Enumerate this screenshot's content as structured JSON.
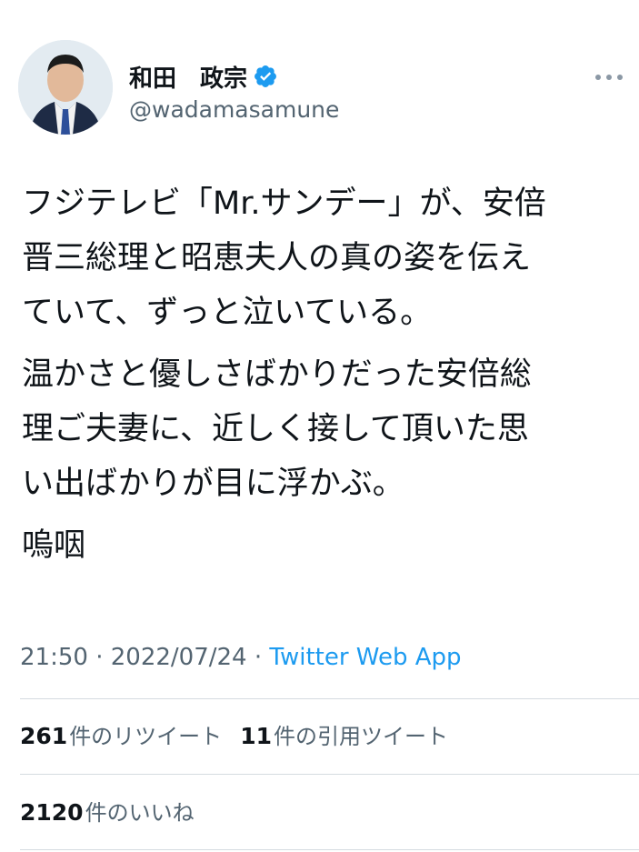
{
  "author": {
    "display_name": "和田　政宗",
    "handle": "@wadamasamune",
    "verified_icon": "verified-badge-icon",
    "avatar_icon": "profile-photo"
  },
  "tweet": {
    "paragraphs": [
      "フジテレビ「Mr.サンデー」が、安倍\n晋三総理と昭恵夫人の真の姿を伝え\nていて、ずっと泣いている。",
      "温かさと優しさばかりだった安倍総\n理ご夫妻に、近しく接して頂いた思\nい出ばかりが目に浮かぶ。",
      "嗚咽"
    ]
  },
  "meta": {
    "time": "21:50",
    "separator": " · ",
    "date": "2022/07/24",
    "source": "Twitter Web App"
  },
  "stats": {
    "retweets_count": "261",
    "retweets_label": "件のリツイート",
    "quotes_count": "11",
    "quotes_label": "件の引用ツイート",
    "likes_count": "2120",
    "likes_label": "件のいいね"
  },
  "colors": {
    "link": "#1d9bf0",
    "secondary_text": "#536471",
    "primary_text": "#0f1419",
    "divider": "#d4dbe0"
  }
}
